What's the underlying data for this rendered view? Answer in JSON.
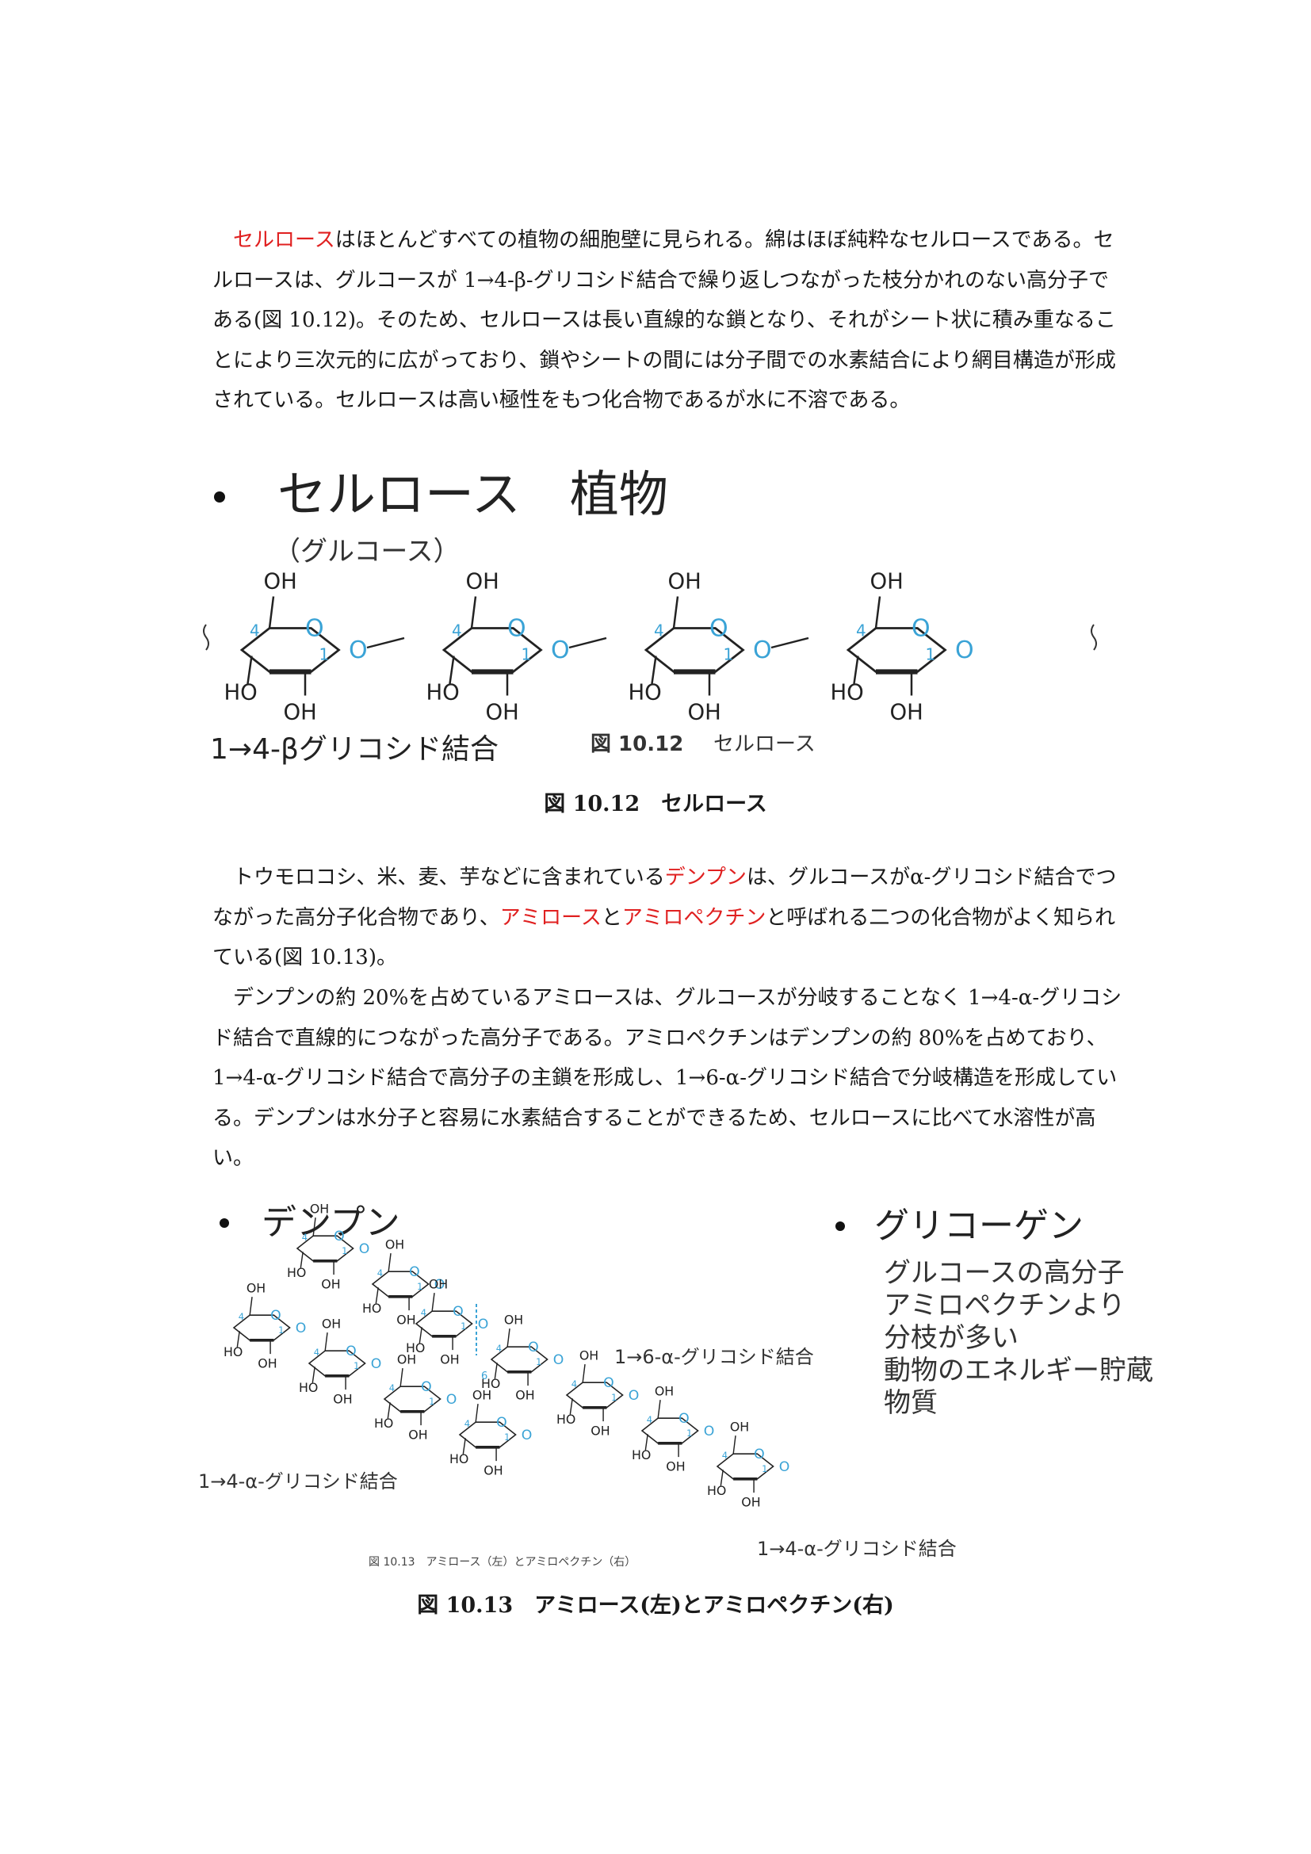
{
  "para1": {
    "term": "セルロース",
    "text": "はほとんどすべての植物の細胞壁に見られる。綿はほぼ純粋なセルロースである。セルロースは、グルコースが 1→4-β-グリコシド結合で繰り返しつながった枝分かれのない高分子である(図 10.12)。そのため、セルロースは長い直線的な鎖となり、それがシート状に積み重なることにより三次元的に広がっており、鎖やシートの間には分子間での水素結合により網目構造が形成されている。セルロースは高い極性をもつ化合物であるが水に不溶である。"
  },
  "fig1": {
    "bullet_title": "セルロース　植物",
    "subtitle": "（グルコース）",
    "bond_label": "1→4-βグリコシド結合",
    "inner_caption_num": "図 10.12",
    "inner_caption_text": "セルロース",
    "oh": "OH",
    "ho": "HO",
    "o": "O",
    "n4": "4",
    "n1": "1"
  },
  "caption1": "図  10.12　セルロース",
  "para2": {
    "t1": "トウモロコシ、米、麦、芋などに含まれている",
    "term1": "デンプン",
    "t2": "は、グルコースがα-グリコシド結合でつながった高分子化合物であり、",
    "term2": "アミロース",
    "t3": "と",
    "term3": "アミロペクチン",
    "t4": "と呼ばれる二つの化合物がよく知られている(図 10.13)。"
  },
  "para3": {
    "text": "デンプンの約 20%を占めているアミロースは、グルコースが分岐することなく 1→4-α-グリコシド結合で直線的につながった高分子である。アミロペクチンはデンプンの約 80%を占めており、1→4-α-グリコシド結合で高分子の主鎖を形成し、1→6-α-グリコシド結合で分岐構造を形成している。デンプンは水分子と容易に水素結合することができるため、セルロースに比べて水溶性が高い。"
  },
  "fig2": {
    "bullet_left": "デンプン",
    "bullet_right": "グリコーゲン",
    "glycogen_lines": [
      "グルコースの高分子",
      "アミロペクチンより",
      "分枝が多い",
      "動物のエネルギー貯蔵",
      "物質"
    ],
    "label_16": "1→6-α-グリコシド結合",
    "label_14_left": "1→4-α-グリコシド結合",
    "label_14_right": "1→4-α-グリコシド結合",
    "inner_caption": "図 10.13　アミロース（左）とアミロペクチン（右）",
    "n6": "6"
  },
  "caption2": "図  10.13　アミロース(左)とアミロペクチン(右)",
  "colors": {
    "red": "#e02020",
    "cyan": "#3aa3d6"
  }
}
